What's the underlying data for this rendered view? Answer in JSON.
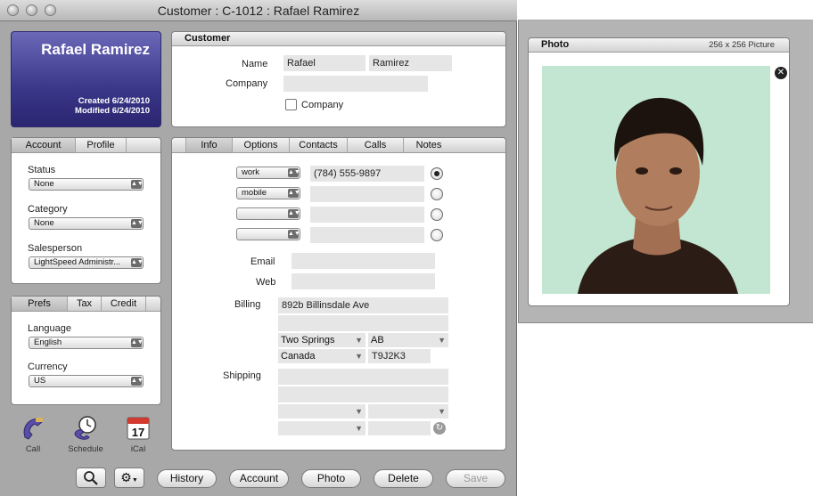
{
  "window": {
    "title": "Customer : C-1012 : Rafael Ramirez"
  },
  "name_card": {
    "name": "Rafael Ramirez",
    "created": "Created 6/24/2010",
    "modified": "Modified 6/24/2010"
  },
  "customer_panel": {
    "title": "Customer",
    "name_label": "Name",
    "first_name": "Rafael",
    "last_name": "Ramirez",
    "company_label": "Company",
    "company_value": "",
    "company_checkbox_label": "Company"
  },
  "account_panel": {
    "tabs": [
      "Account",
      "Profile"
    ],
    "status_label": "Status",
    "status_value": "None",
    "category_label": "Category",
    "category_value": "None",
    "salesperson_label": "Salesperson",
    "salesperson_value": "LightSpeed Administr..."
  },
  "prefs_panel": {
    "tabs": [
      "Prefs",
      "Tax",
      "Credit"
    ],
    "language_label": "Language",
    "language_value": "English",
    "currency_label": "Currency",
    "currency_value": "US"
  },
  "main_tabs": [
    "Info",
    "Options",
    "Contacts",
    "Calls",
    "Notes"
  ],
  "phones": [
    {
      "type": "work",
      "number": "(784) 555-9897",
      "primary": true
    },
    {
      "type": "mobile",
      "number": "",
      "primary": false
    },
    {
      "type": "",
      "number": "",
      "primary": false
    },
    {
      "type": "",
      "number": "",
      "primary": false
    }
  ],
  "info": {
    "email_label": "Email",
    "email_value": "",
    "web_label": "Web",
    "web_value": "",
    "billing_label": "Billing",
    "billing_line1": "892b Billinsdale Ave",
    "billing_line2": "",
    "billing_city": "Two Springs",
    "billing_state": "AB",
    "billing_country": "Canada",
    "billing_zip": "T9J2K3",
    "shipping_label": "Shipping"
  },
  "tools": [
    {
      "label": "Call",
      "icon": "phone-icon"
    },
    {
      "label": "Schedule",
      "icon": "clock-phone-icon"
    },
    {
      "label": "iCal",
      "icon": "calendar-icon",
      "day": "17"
    }
  ],
  "buttons": {
    "history": "History",
    "account": "Account",
    "photo": "Photo",
    "delete": "Delete",
    "save": "Save"
  },
  "photo": {
    "title": "Photo",
    "info": "256 x 256 Picture",
    "photo_colors": {
      "background": "#bfe3cf",
      "shirt": "#2c1c16",
      "skin": "#b07d5e",
      "hair": "#1c130e"
    }
  }
}
